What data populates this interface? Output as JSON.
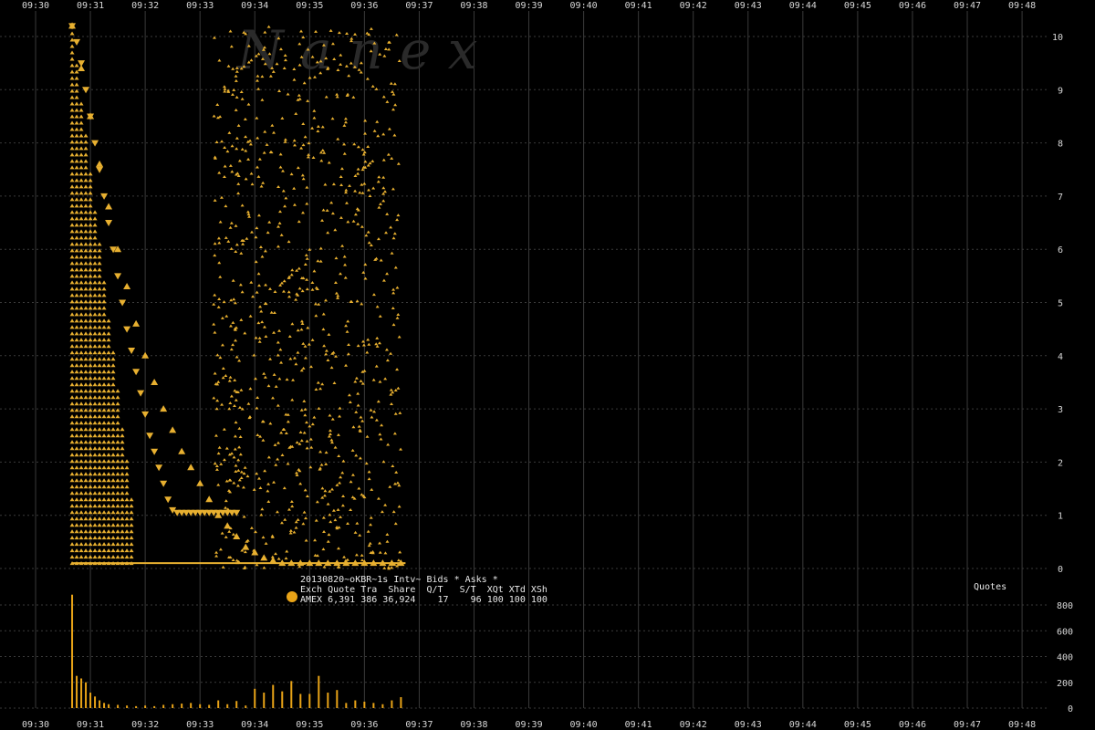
{
  "watermark": "N a n e x",
  "legend": {
    "line1": "20130820~oKBR~1s Intv~ Bids * Asks *",
    "line2": "Exch Quote Tra  Share  Q/T   S/T  XQt XTd XSh",
    "line3": "AMEX 6,391 386 36,924    17    96 100 100 100",
    "marker_color": "#e8a317"
  },
  "volume_label": "Quotes",
  "colors": {
    "quote": "#e8b030",
    "volume": "#e8a317",
    "grid": "#3a3a3a",
    "text": "#d8d8d8"
  },
  "chart_data": [
    {
      "type": "scatter",
      "title": "20130820~oKBR~1s Intv~ Bids * Asks *",
      "x_ticks": [
        "09:30",
        "09:31",
        "09:32",
        "09:33",
        "09:34",
        "09:35",
        "09:36",
        "09:37",
        "09:38",
        "09:39",
        "09:40",
        "09:41",
        "09:42",
        "09:43",
        "09:44",
        "09:45",
        "09:46",
        "09:47",
        "09:48"
      ],
      "y_ticks": [
        0,
        1,
        2,
        3,
        4,
        5,
        6,
        7,
        8,
        9,
        10
      ],
      "ylim": [
        0,
        10.3
      ],
      "grid": true,
      "series": [
        {
          "marker": "bid-up-triangle",
          "x": [
            "09:30:40",
            "09:30:50",
            "09:31:00",
            "09:31:10",
            "09:31:20",
            "09:31:30",
            "09:31:40",
            "09:31:50",
            "09:32:00",
            "09:32:10",
            "09:32:20",
            "09:32:30",
            "09:32:40",
            "09:32:50",
            "09:33:00",
            "09:33:10",
            "09:33:20",
            "09:33:30",
            "09:33:40",
            "09:33:50",
            "09:34:00",
            "09:34:10",
            "09:34:20",
            "09:34:30",
            "09:34:40",
            "09:34:50",
            "09:35:00",
            "09:35:10",
            "09:35:20",
            "09:35:30",
            "09:35:40",
            "09:35:50",
            "09:36:00",
            "09:36:10",
            "09:36:20",
            "09:36:30",
            "09:36:40"
          ],
          "y": [
            10.2,
            9.4,
            8.5,
            7.6,
            6.8,
            6.0,
            5.3,
            4.6,
            4.0,
            3.5,
            3.0,
            2.6,
            2.2,
            1.9,
            1.6,
            1.3,
            1.0,
            0.8,
            0.6,
            0.4,
            0.3,
            0.2,
            0.15,
            0.1,
            0.1,
            0.1,
            0.1,
            0.1,
            0.1,
            0.1,
            0.1,
            0.1,
            0.1,
            0.1,
            0.1,
            0.1,
            0.1
          ]
        },
        {
          "marker": "ask-down-triangle",
          "x": [
            "09:30:40",
            "09:30:45",
            "09:30:50",
            "09:30:55",
            "09:31:00",
            "09:31:05",
            "09:31:10",
            "09:31:15",
            "09:31:20",
            "09:31:25",
            "09:31:30",
            "09:31:35",
            "09:31:40",
            "09:31:45",
            "09:31:50",
            "09:31:55",
            "09:32:00",
            "09:32:05",
            "09:32:10",
            "09:32:15",
            "09:32:20",
            "09:32:25",
            "09:32:30",
            "09:32:35",
            "09:32:40",
            "09:32:45",
            "09:32:50",
            "09:32:55",
            "09:33:00",
            "09:33:05",
            "09:33:10",
            "09:33:15",
            "09:33:20",
            "09:33:25",
            "09:33:30",
            "09:33:35",
            "09:33:40"
          ],
          "y": [
            10.2,
            9.9,
            9.5,
            9.0,
            8.5,
            8.0,
            7.5,
            7.0,
            6.5,
            6.0,
            5.5,
            5.0,
            4.5,
            4.1,
            3.7,
            3.3,
            2.9,
            2.5,
            2.2,
            1.9,
            1.6,
            1.3,
            1.1,
            1.05,
            1.05,
            1.05,
            1.05,
            1.05,
            1.05,
            1.05,
            1.05,
            1.05,
            1.05,
            1.05,
            1.05,
            1.05,
            1.05
          ]
        }
      ]
    },
    {
      "type": "bar",
      "title": "Quotes",
      "y_ticks": [
        0,
        200,
        400,
        600,
        800
      ],
      "ylim": [
        0,
        900
      ],
      "x": [
        "09:30:40",
        "09:30:45",
        "09:30:50",
        "09:30:55",
        "09:31:00",
        "09:31:05",
        "09:31:10",
        "09:31:15",
        "09:31:20",
        "09:31:30",
        "09:31:40",
        "09:31:50",
        "09:32:00",
        "09:32:10",
        "09:32:20",
        "09:32:30",
        "09:32:40",
        "09:32:50",
        "09:33:00",
        "09:33:10",
        "09:33:20",
        "09:33:30",
        "09:33:40",
        "09:33:50",
        "09:34:00",
        "09:34:10",
        "09:34:20",
        "09:34:30",
        "09:34:40",
        "09:34:50",
        "09:35:00",
        "09:35:10",
        "09:35:20",
        "09:35:30",
        "09:35:40",
        "09:35:50",
        "09:36:00",
        "09:36:10",
        "09:36:20",
        "09:36:30",
        "09:36:40"
      ],
      "values": [
        880,
        250,
        230,
        200,
        120,
        90,
        60,
        40,
        30,
        25,
        20,
        15,
        20,
        15,
        25,
        30,
        35,
        40,
        30,
        25,
        60,
        30,
        55,
        20,
        150,
        120,
        180,
        130,
        210,
        110,
        110,
        250,
        120,
        140,
        40,
        60,
        50,
        40,
        30,
        60,
        85
      ]
    }
  ]
}
